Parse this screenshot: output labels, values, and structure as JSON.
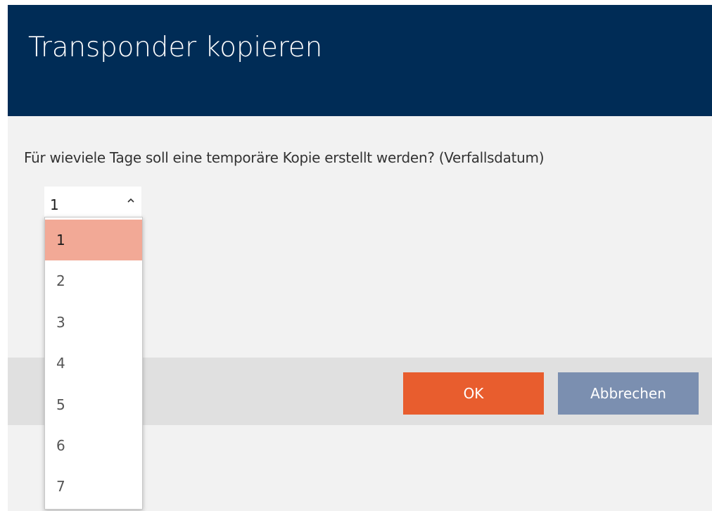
{
  "dialog": {
    "title": "Transponder kopieren",
    "question": "Für wieviele Tage soll eine temporäre Kopie erstellt werden? (Verfallsdatum)",
    "select": {
      "value": "1",
      "options": [
        "1",
        "2",
        "3",
        "4",
        "5",
        "6",
        "7"
      ],
      "selected_index": 0
    },
    "buttons": {
      "ok_label": "OK",
      "cancel_label": "Abbrechen"
    }
  },
  "colors": {
    "title_bar": "#002c56",
    "ok_button": "#e85d2e",
    "cancel_button": "#7b8fb0",
    "selected_option": "#f2a996"
  },
  "icons": {
    "select_chevron": "chevron-up-icon"
  }
}
